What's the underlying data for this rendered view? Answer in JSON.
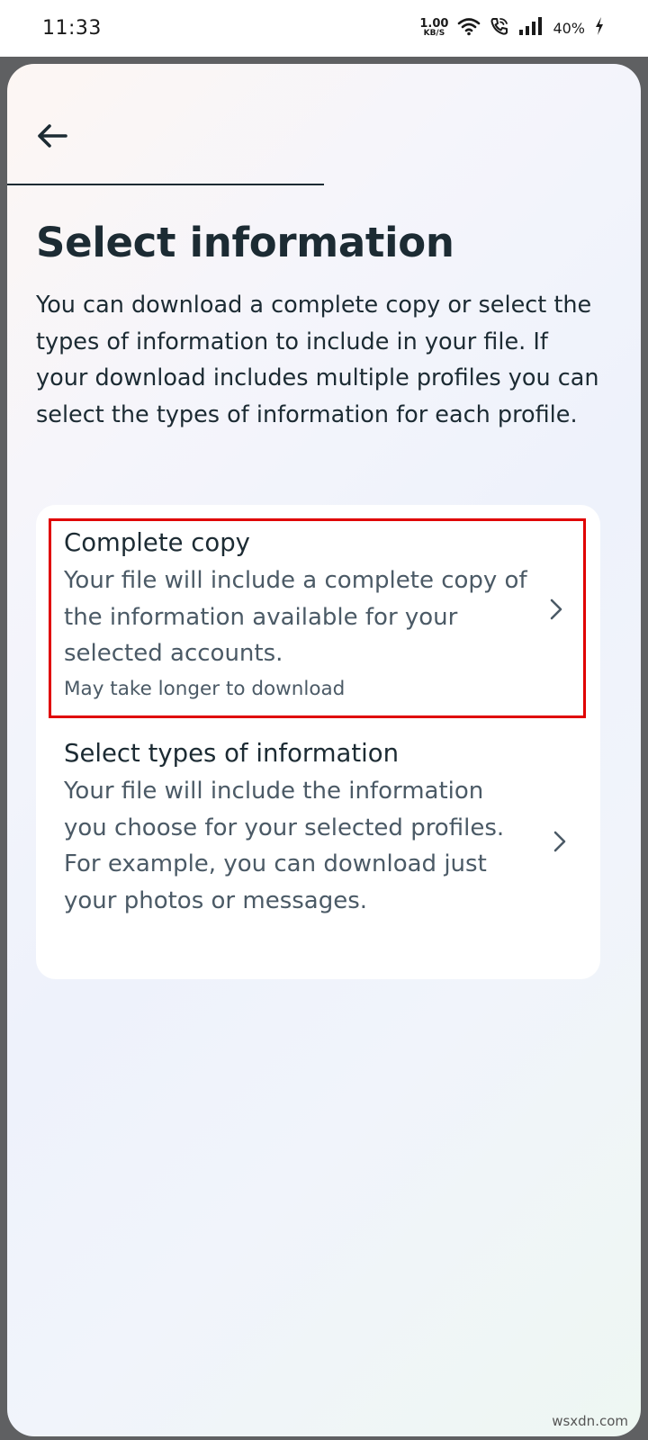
{
  "status_bar": {
    "time": "11:33",
    "net_speed_value": "1.00",
    "net_speed_unit": "KB/S",
    "battery": "40%",
    "icons": [
      "wifi-icon",
      "wifi-call-icon",
      "signal-icon",
      "charging-icon"
    ]
  },
  "header": {
    "back_icon": "arrow-left-icon",
    "progress_fraction": 0.5
  },
  "page": {
    "title": "Select information",
    "description": "You can download a complete copy or select the types of information to include in your file. If your download includes multiple profiles you can select the types of information for each profile."
  },
  "options": [
    {
      "title": "Complete copy",
      "description": "Your file will include a complete copy of the information available for your selected accounts.",
      "note": "May take longer to download",
      "highlight_color": "#e00000"
    },
    {
      "title": "Select types of information",
      "description": "Your file will include the information you choose for your selected profiles. For example, you can download just your photos or messages."
    }
  ],
  "watermark": "wsxdn.com"
}
